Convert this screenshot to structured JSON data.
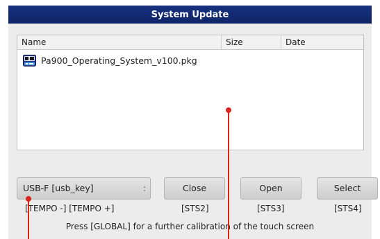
{
  "window": {
    "title": "System Update"
  },
  "file_list": {
    "columns": [
      "Name",
      "Size",
      "Date"
    ],
    "rows": [
      {
        "name": "Pa900_Operating_System_v100.pkg",
        "size": "",
        "date": "",
        "icon": "package-file-icon"
      }
    ]
  },
  "device_selector": {
    "value": "USB-F [usb_key]",
    "arrow_glyph": ":"
  },
  "buttons": {
    "close_label": "Close",
    "open_label": "Open",
    "select_label": "Select"
  },
  "hints": {
    "tempo": "[TEMPO -]  [TEMPO +]",
    "sts2": "[STS2]",
    "sts3": "[STS3]",
    "sts4": "[STS4]"
  },
  "footer": {
    "message": "Press [GLOBAL] for a further calibration of the touch screen"
  },
  "colors": {
    "titlebar": "#17317f",
    "panel": "#ececec",
    "marker": "#d9261c"
  }
}
